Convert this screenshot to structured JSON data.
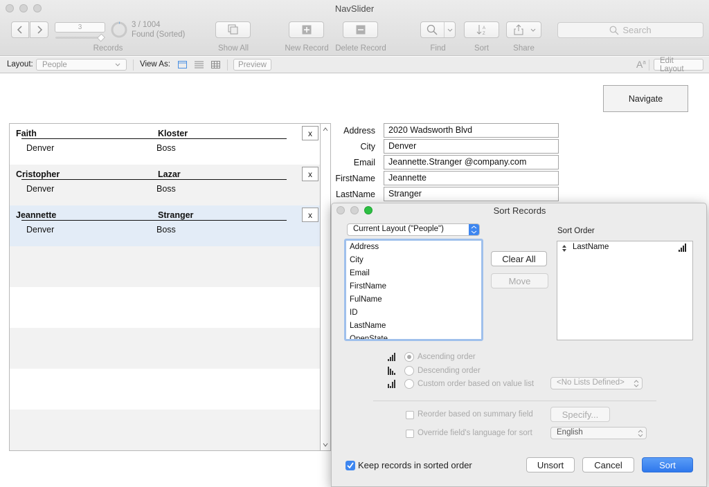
{
  "window": {
    "title": "NavSlider"
  },
  "toolbar": {
    "record_number": "3",
    "record_count": "3 / 1004",
    "found_status": "Found (Sorted)",
    "records_label": "Records",
    "show_all_label": "Show All",
    "new_record_label": "New Record",
    "delete_record_label": "Delete Record",
    "find_label": "Find",
    "sort_label": "Sort",
    "share_label": "Share",
    "search_placeholder": "Search"
  },
  "layout_bar": {
    "layout_label": "Layout:",
    "layout_value": "People",
    "view_as_label": "View As:",
    "preview_label": "Preview",
    "edit_layout_label": "Edit Layout"
  },
  "navigate_button": "Navigate",
  "portal": {
    "rows": [
      {
        "first": "Faith",
        "last": "Kloster",
        "city": "Denver",
        "title": "Boss",
        "delete": "x"
      },
      {
        "first": "Cristopher",
        "last": "Lazar",
        "city": "Denver",
        "title": "Boss",
        "delete": "x"
      },
      {
        "first": "Jeannette",
        "last": "Stranger",
        "city": "Denver",
        "title": "Boss",
        "delete": "x"
      }
    ]
  },
  "record": {
    "fields": [
      {
        "label": "Address",
        "value": "2020 Wadsworth Blvd"
      },
      {
        "label": "City",
        "value": "Denver"
      },
      {
        "label": "Email",
        "value": "Jeannette.Stranger @company.com"
      },
      {
        "label": "FirstName",
        "value": "Jeannette"
      },
      {
        "label": "LastName",
        "value": "Stranger"
      }
    ]
  },
  "sort_dialog": {
    "title": "Sort Records",
    "table_select": "Current Layout (\"People\")",
    "fields": [
      "Address",
      "City",
      "Email",
      "FirstName",
      "FulName",
      "ID",
      "LastName",
      "OpenState"
    ],
    "clear_all_label": "Clear All",
    "move_label": "Move",
    "sort_order_label": "Sort Order",
    "sort_order_items": [
      "LastName"
    ],
    "ascending_label": "Ascending order",
    "descending_label": "Descending order",
    "custom_label": "Custom order based on value list",
    "value_list_select": "<No Lists Defined>",
    "reorder_label": "Reorder based on summary field",
    "specify_label": "Specify...",
    "override_label": "Override field's language for sort",
    "language_select": "English",
    "keep_sorted_label": "Keep records in sorted order",
    "keep_sorted_checked": true,
    "unsort_label": "Unsort",
    "cancel_label": "Cancel",
    "sort_label": "Sort"
  },
  "colors": {
    "accent": "#3d86f0",
    "selected_row": "#e3ecf7",
    "stripe": "#f2f2f2"
  }
}
